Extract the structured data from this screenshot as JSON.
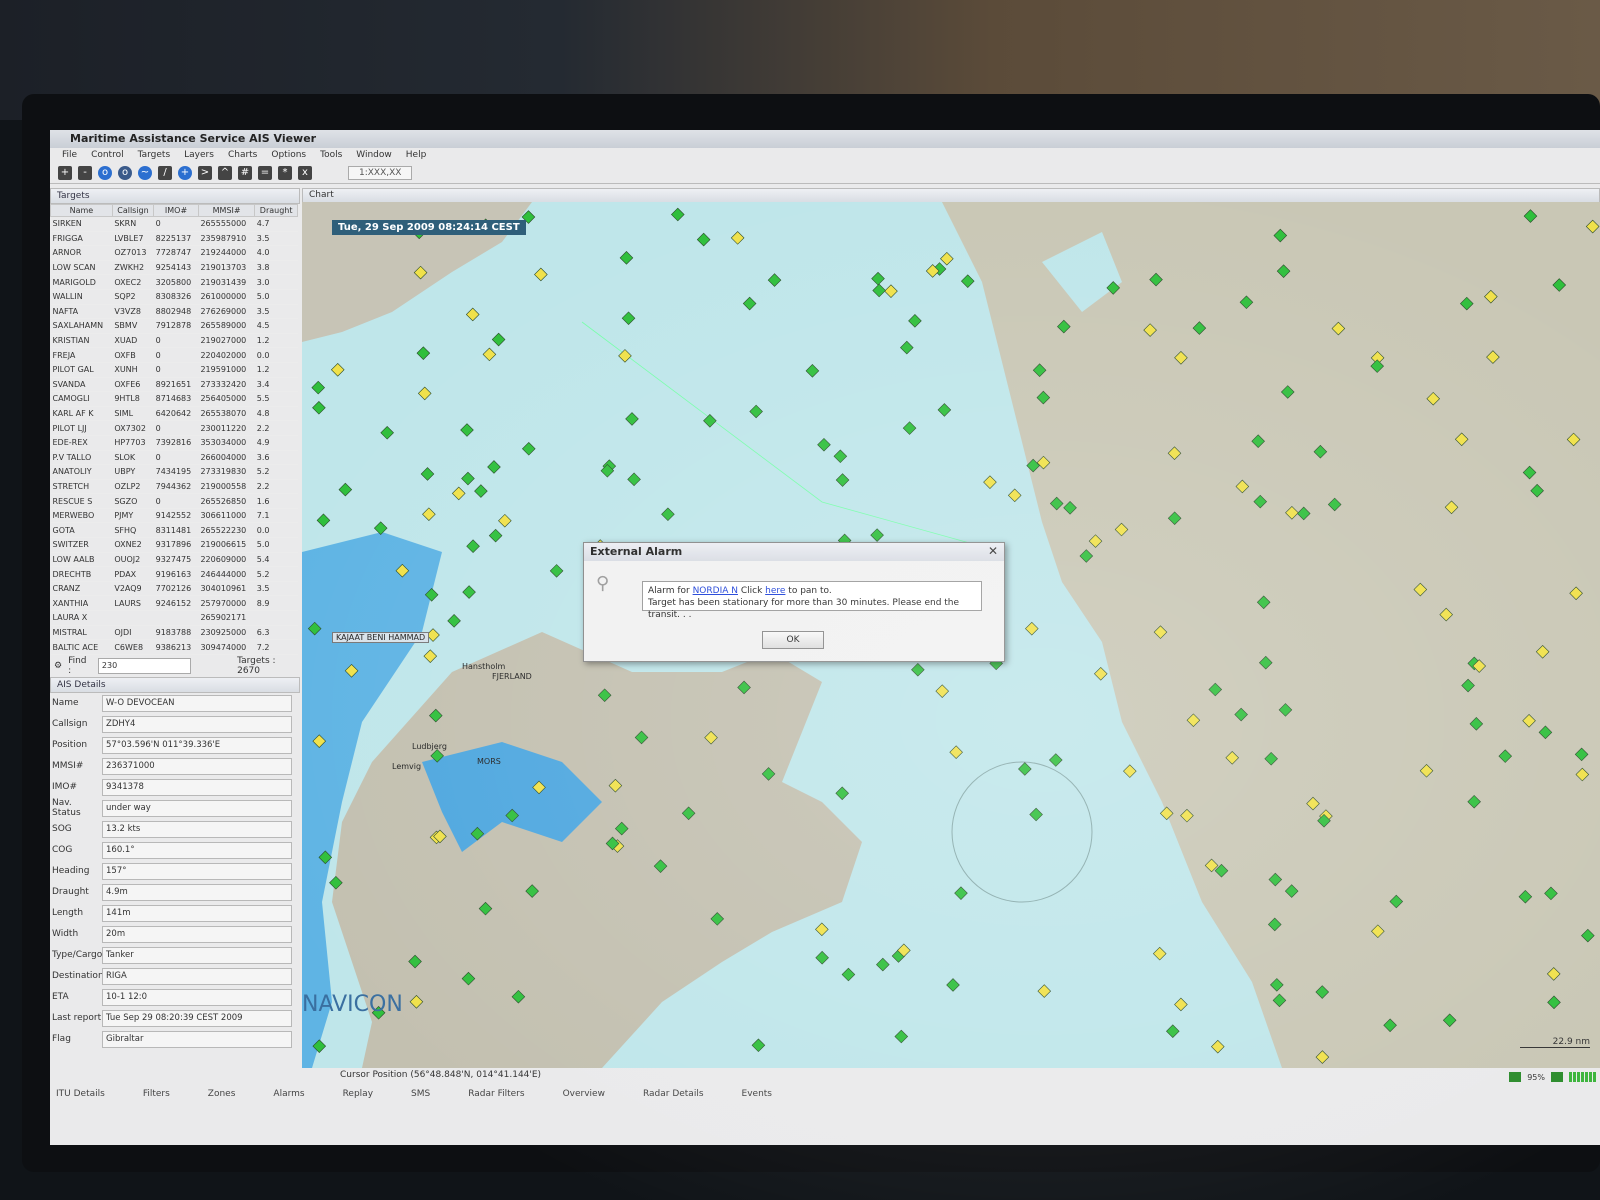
{
  "app": {
    "title": "Maritime Assistance Service AIS Viewer",
    "menu": [
      "File",
      "Control",
      "Targets",
      "Layers",
      "Charts",
      "Options",
      "Tools",
      "Window",
      "Help"
    ],
    "toolbar_field": "1:XXX,XX"
  },
  "targets_panel": {
    "title": "Targets",
    "columns": [
      "Name",
      "Callsign",
      "IMO#",
      "MMSI#",
      "Draught"
    ],
    "rows": [
      [
        "SIRKEN",
        "SKRN",
        "0",
        "265555000",
        "4.7"
      ],
      [
        "FRIGGA",
        "LVBLE7",
        "8225137",
        "235987910",
        "3.5"
      ],
      [
        "ARNOR",
        "OZ7013",
        "7728747",
        "219244000",
        "4.0"
      ],
      [
        "LOW SCAN",
        "ZWKH2",
        "9254143",
        "219013703",
        "3.8"
      ],
      [
        "MARIGOLD",
        "OXEC2",
        "3205800",
        "219031439",
        "3.0"
      ],
      [
        "WALLIN",
        "SQP2",
        "8308326",
        "261000000",
        "5.0"
      ],
      [
        "NAFTA",
        "V3VZ8",
        "8802948",
        "276269000",
        "3.5"
      ],
      [
        "SAXLAHAMN",
        "SBMV",
        "7912878",
        "265589000",
        "4.5"
      ],
      [
        "KRISTIAN",
        "XUAD",
        "0",
        "219027000",
        "1.2"
      ],
      [
        "FREJA",
        "OXFB",
        "0",
        "220402000",
        "0.0"
      ],
      [
        "PILOT GAL",
        "XUNH",
        "0",
        "219591000",
        "1.2"
      ],
      [
        "SVANDA",
        "OXFE6",
        "8921651",
        "273332420",
        "3.4"
      ],
      [
        "CAMOGLI",
        "9HTL8",
        "8714683",
        "256405000",
        "5.5"
      ],
      [
        "KARL AF K",
        "SIML",
        "6420642",
        "265538070",
        "4.8"
      ],
      [
        "PILOT LJJ",
        "OX7302",
        "0",
        "230011220",
        "2.2"
      ],
      [
        "EDE-REX",
        "HP7703",
        "7392816",
        "353034000",
        "4.9"
      ],
      [
        "P.V TALLO",
        "SLOK",
        "0",
        "266004000",
        "3.6"
      ],
      [
        "ANATOLIY",
        "UBPY",
        "7434195",
        "273319830",
        "5.2"
      ],
      [
        "STRETCH",
        "OZLP2",
        "7944362",
        "219000558",
        "2.2"
      ],
      [
        "RESCUE S",
        "SGZO",
        "0",
        "265526850",
        "1.6"
      ],
      [
        "MERWEBO",
        "PJMY",
        "9142552",
        "306611000",
        "7.1"
      ],
      [
        "GOTA",
        "SFHQ",
        "8311481",
        "265522230",
        "0.0"
      ],
      [
        "SWITZER",
        "OXNE2",
        "9317896",
        "219006615",
        "5.0"
      ],
      [
        "LOW AALB",
        "OUOJ2",
        "9327475",
        "220609000",
        "5.4"
      ],
      [
        "DRECHTB",
        "PDAX",
        "9196163",
        "246444000",
        "5.2"
      ],
      [
        "CRANZ",
        "V2AQ9",
        "7702126",
        "304010961",
        "3.5"
      ],
      [
        "XANTHIA",
        "LAURS",
        "9246152",
        "257970000",
        "8.9"
      ],
      [
        "LAURA X",
        "",
        "",
        "265902171",
        ""
      ],
      [
        "MISTRAL",
        "OJDI",
        "9183788",
        "230925000",
        "6.3"
      ],
      [
        "BALTIC ACE",
        "C6WE8",
        "9386213",
        "309474000",
        "7.2"
      ]
    ],
    "find_label": "Find :",
    "find_value": "230",
    "targets_count": "Targets : 2670"
  },
  "ais_details": {
    "title": "AIS Details",
    "fields": [
      {
        "label": "Name",
        "value": "W-O DEVOCEAN"
      },
      {
        "label": "Callsign",
        "value": "ZDHY4"
      },
      {
        "label": "Position",
        "value": "57°03.596'N 011°39.336'E"
      },
      {
        "label": "MMSI#",
        "value": "236371000"
      },
      {
        "label": "IMO#",
        "value": "9341378"
      },
      {
        "label": "Nav. Status",
        "value": "under way"
      },
      {
        "label": "SOG",
        "value": "13.2 kts"
      },
      {
        "label": "COG",
        "value": "160.1°"
      },
      {
        "label": "Heading",
        "value": "157°"
      },
      {
        "label": "Draught",
        "value": "4.9m"
      },
      {
        "label": "Length",
        "value": "141m"
      },
      {
        "label": "Width",
        "value": "20m"
      },
      {
        "label": "Type/Cargo",
        "value": "Tanker"
      },
      {
        "label": "Destination",
        "value": "RIGA"
      },
      {
        "label": "ETA",
        "value": "10-1 12:0"
      },
      {
        "label": "Last report",
        "value": "Tue Sep 29 08:20:39 CEST 2009"
      },
      {
        "label": "Flag",
        "value": "Gibraltar"
      }
    ]
  },
  "chart": {
    "tab": "Chart",
    "timestamp": "Tue, 29 Sep 2009 08:24:14 CEST",
    "place_labels": [
      "KAJAAT BENI HAMMAD",
      "Lemvig",
      "Ludbjerg",
      "MORS",
      "FJERLAND",
      "Hanstholm"
    ],
    "logo": "NAVICON",
    "scale": "22.9 nm",
    "cursor_position": "Cursor Position (56°48.848'N, 014°41.144'E)"
  },
  "alarm_dialog": {
    "title": "External Alarm",
    "prefix": "Alarm for ",
    "vessel_link": "NORDIA N",
    "mid": " Click ",
    "here_link": "here",
    "suffix": " to pan to.",
    "message2": "Target has been stationary for more than 30 minutes. Please end the transit. . .",
    "ok": "OK"
  },
  "bottom_tabs": [
    "ITU Details",
    "Filters",
    "Zones",
    "Alarms",
    "Replay",
    "SMS",
    "Radar Filters",
    "Overview",
    "Radar Details",
    "Events"
  ],
  "status": {
    "percent": "95%"
  },
  "colors": {
    "sea": "#bfe6ea",
    "deep": "#5fb4e4",
    "land": "#c7c4b6",
    "target": "#2fbf3c",
    "target_yellow": "#f0e14a"
  }
}
